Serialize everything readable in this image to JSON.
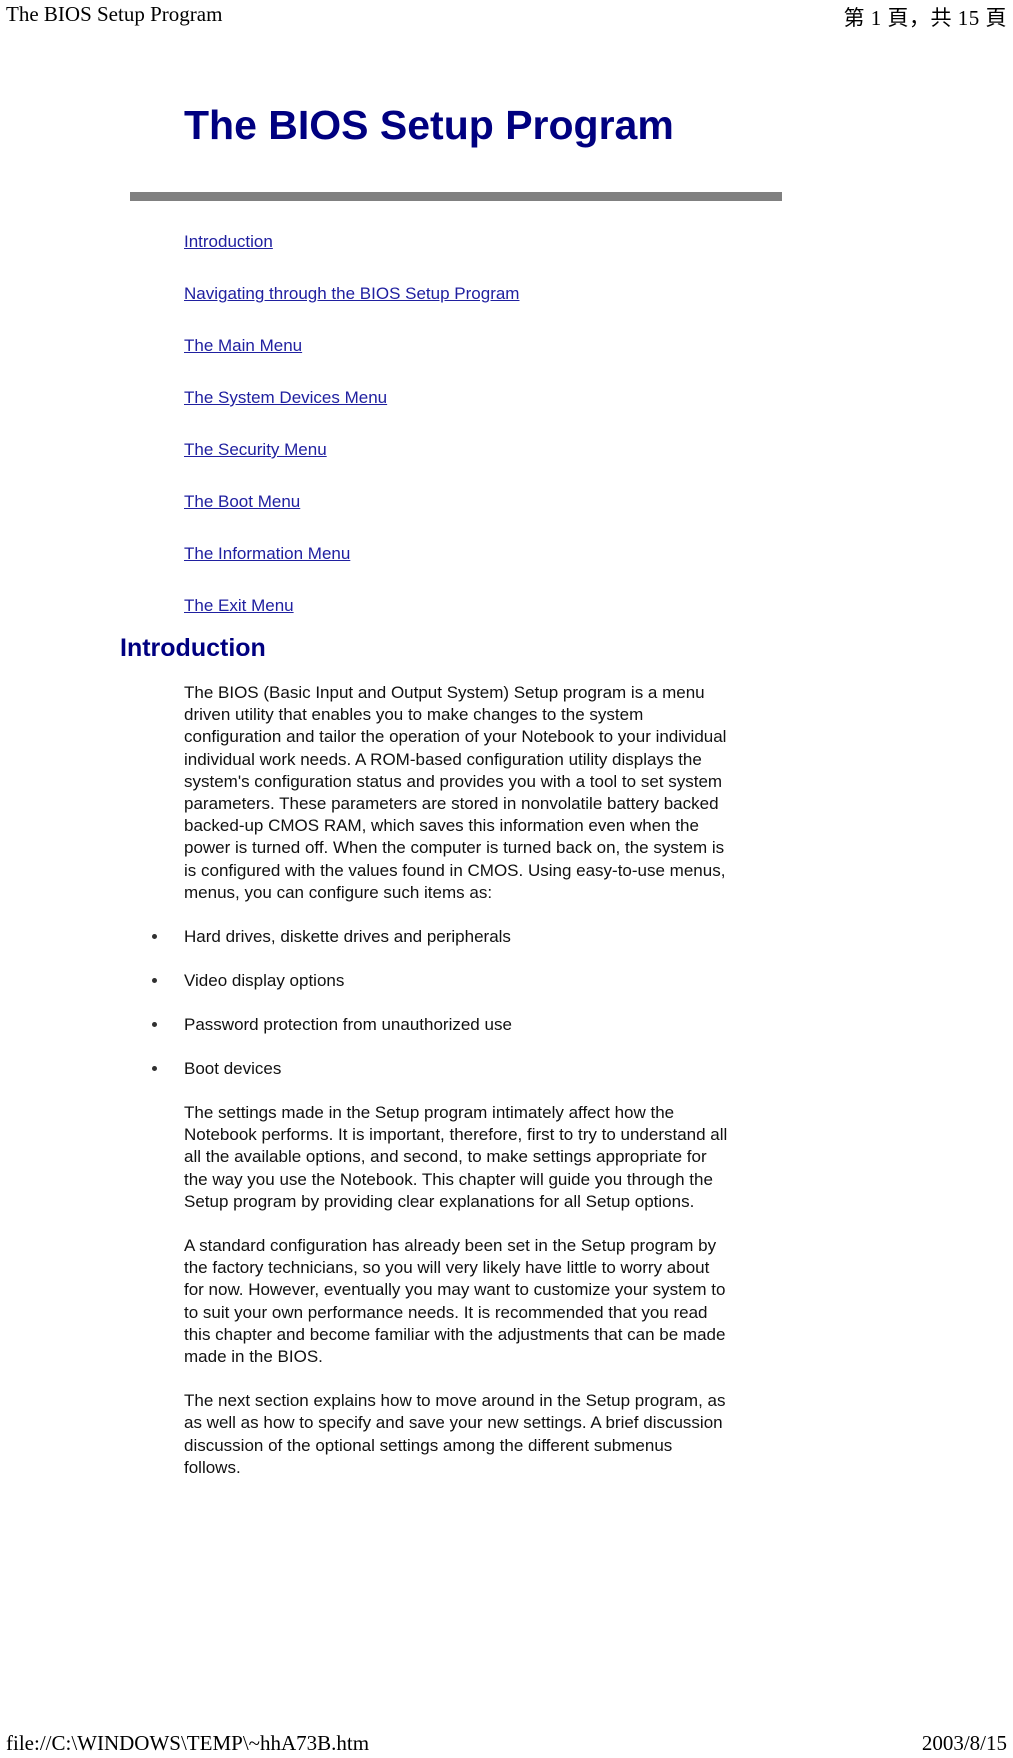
{
  "print_header": {
    "left": "The BIOS Setup Program",
    "right": "第 1 頁，共 15 頁"
  },
  "print_footer": {
    "left": "file://C:\\WINDOWS\\TEMP\\~hhA73B.htm",
    "right": "2003/8/15"
  },
  "document": {
    "title": "The BIOS Setup Program",
    "title_color": "#000080",
    "rule_color": "#808080",
    "link_color": "#2020a0",
    "toc": [
      {
        "label": "Introduction"
      },
      {
        "label": "Navigating through the BIOS Setup Program"
      },
      {
        "label": "The Main Menu"
      },
      {
        "label": "The System Devices Menu"
      },
      {
        "label": "The Security Menu"
      },
      {
        "label": "The Boot Menu"
      },
      {
        "label": "The Information Menu"
      },
      {
        "label": "The Exit Menu"
      }
    ],
    "section": {
      "heading": "Introduction",
      "paragraph_1": "The BIOS (Basic Input and Output System) Setup program is a menu\ndriven utility that enables you to make changes to the system\nconfiguration and tailor the operation of your Notebook to your individual\nindividual work needs. A ROM-based configuration utility displays the\nsystem's configuration status and provides you with a tool to set system\nparameters. These parameters are stored in nonvolatile battery backed\nbacked-up CMOS RAM, which saves this information even when the\npower is turned off. When the computer is turned back on, the system is\nis configured with the values found in CMOS. Using easy-to-use menus,\nmenus, you can configure such items as:",
      "bullets": [
        "Hard drives, diskette drives and peripherals",
        "Video display options",
        "Password protection from unauthorized use",
        "Boot devices"
      ],
      "paragraph_2": "The settings made in the Setup program intimately affect how the\nNotebook performs. It is important, therefore, first to try to understand all\nall the available options, and second, to make settings appropriate for\nthe way you use the Notebook. This chapter will guide you through the\nSetup program by providing clear explanations for all Setup options.",
      "paragraph_3": "A standard configuration has already been set in the Setup program by\nthe factory technicians, so you will very likely have little to worry about\nfor now. However, eventually you may want to customize your system to\nto suit your own performance needs. It is recommended that you read\nthis chapter and become familiar with the adjustments that can be made\nmade in the BIOS.",
      "paragraph_4": "The next section explains how to move around in the Setup program, as\nas well as how to specify and save your new settings. A brief discussion\ndiscussion of the optional settings among the different submenus\nfollows."
    }
  }
}
